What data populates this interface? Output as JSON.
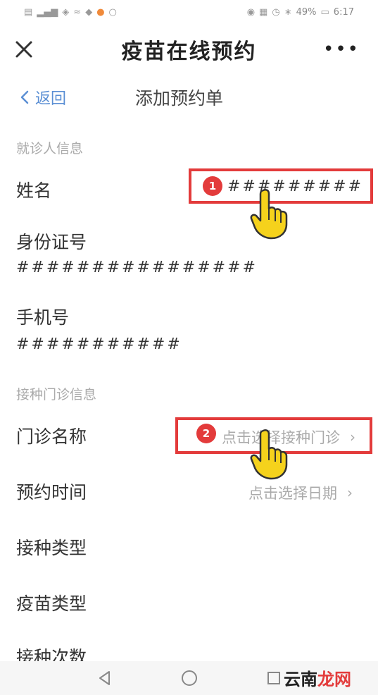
{
  "status_bar": {
    "left_icons": [
      "sim-icon",
      "signal-icon",
      "wifi-icon",
      "nfc-icon",
      "shield-icon",
      "person-icon",
      "chat-icon"
    ],
    "battery": "49%",
    "time": "6:17"
  },
  "header": {
    "title": "疫苗在线预约",
    "close_icon": "close-icon",
    "more_label": "•••"
  },
  "subnav": {
    "back_label": "返回",
    "title": "添加预约单"
  },
  "sections": {
    "patient": {
      "label": "就诊人信息",
      "name_label": "姓名",
      "name_value": "#########",
      "id_label": "身份证号",
      "id_value": "################",
      "phone_label": "手机号",
      "phone_value": "###########"
    },
    "clinic": {
      "label": "接种门诊信息",
      "clinic_label": "门诊名称",
      "clinic_placeholder": "点击选择接种门诊",
      "time_label": "预约时间",
      "time_placeholder": "点击选择日期",
      "type_label": "接种类型",
      "vaccine_label": "疫苗类型",
      "count_label": "接种次数"
    }
  },
  "annotations": {
    "step1": "1",
    "step2": "2"
  },
  "watermark": {
    "left": "云南",
    "right": "龙网"
  },
  "colors": {
    "accent_blue": "#5b8fd4",
    "highlight_red": "#e33b3b",
    "hand_yellow": "#f5d21c"
  }
}
